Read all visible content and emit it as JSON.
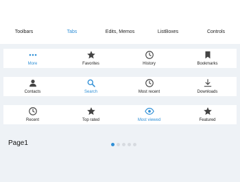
{
  "colors": {
    "accent": "#2f8fd6",
    "icon": "#444444",
    "background": "#eef2f6"
  },
  "menu": {
    "items": [
      {
        "label": "Toolbars"
      },
      {
        "label": "Tabs"
      },
      {
        "label": "Edits, Memos"
      },
      {
        "label": "ListBoxes"
      },
      {
        "label": "Controls"
      }
    ],
    "active_index": 1
  },
  "tabbars": [
    {
      "selected_index": 0,
      "tabs": [
        {
          "label": "More",
          "icon": "more-icon"
        },
        {
          "label": "Favorites",
          "icon": "star-icon"
        },
        {
          "label": "History",
          "icon": "clock-icon"
        },
        {
          "label": "Bookmarks",
          "icon": "bookmark-icon"
        }
      ]
    },
    {
      "selected_index": 1,
      "tabs": [
        {
          "label": "Contacts",
          "icon": "person-icon"
        },
        {
          "label": "Search",
          "icon": "search-icon"
        },
        {
          "label": "Most recent",
          "icon": "clock-icon"
        },
        {
          "label": "Downloads",
          "icon": "download-icon"
        }
      ]
    },
    {
      "selected_index": 2,
      "tabs": [
        {
          "label": "Recent",
          "icon": "clock-icon"
        },
        {
          "label": "Top rated",
          "icon": "star-icon"
        },
        {
          "label": "Most viewed",
          "icon": "eye-icon"
        },
        {
          "label": "Featured",
          "icon": "star-icon"
        }
      ]
    }
  ],
  "pager": {
    "page_label": "Page1",
    "page_count": 5,
    "current_page": 1
  }
}
